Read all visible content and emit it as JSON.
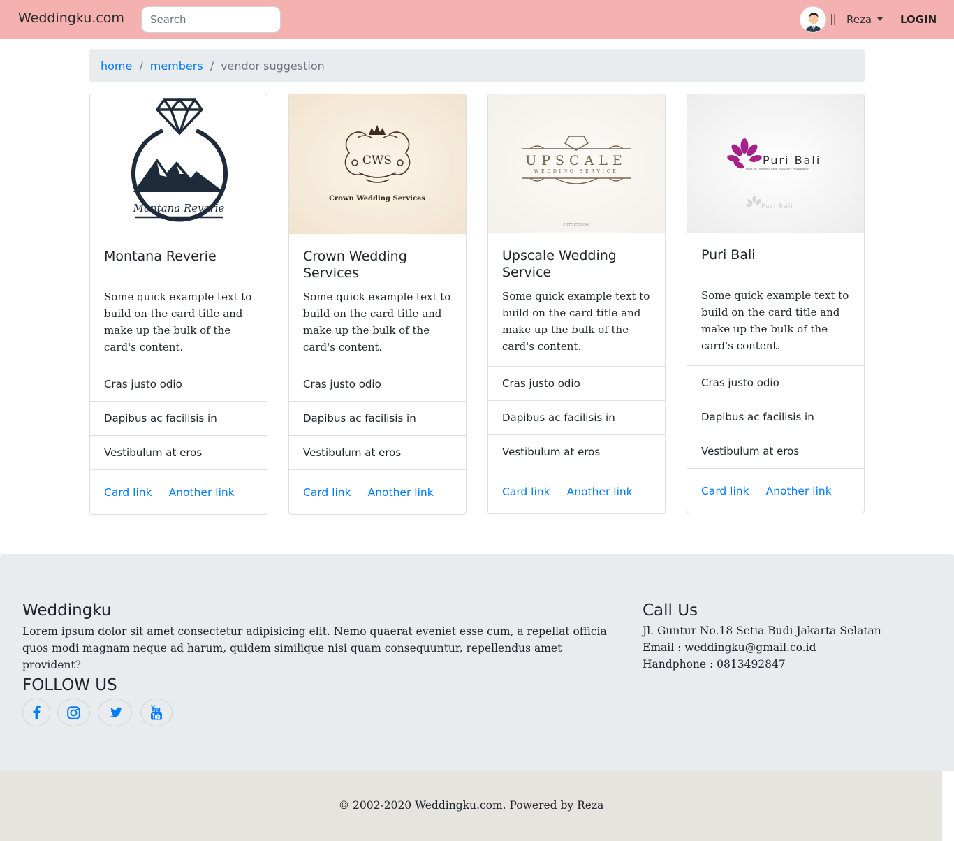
{
  "navbar": {
    "brand": "Weddingku.com",
    "search_placeholder": "Search",
    "divider": "||",
    "user_name": "Reza",
    "login_label": "LOGIN"
  },
  "breadcrumb": {
    "items": [
      "home",
      "members"
    ],
    "separator": "/",
    "active": "vendor suggestion"
  },
  "cards": [
    {
      "title": "Montana Reverie",
      "logo_text": "Montana Reverie",
      "text": "Some quick example text to build on the card title and make up the bulk of the card's content.",
      "list": [
        "Cras justo odio",
        "Dapibus ac facilisis in",
        "Vestibulum at eros"
      ],
      "link1": "Card link",
      "link2": "Another link"
    },
    {
      "title": "Crown Wedding Services",
      "logo_text": "CWS",
      "logo_subtext": "Crown Wedding Services",
      "text": "Some quick example text to build on the card title and make up the bulk of the card's content.",
      "list": [
        "Cras justo odio",
        "Dapibus ac facilisis in",
        "Vestibulum at eros"
      ],
      "link1": "Card link",
      "link2": "Another link"
    },
    {
      "title": "Upscale Wedding Service",
      "logo_text": "UPSCALE",
      "logo_subtext": "WEDDING SERVICE",
      "logo_footer": "FOTOJET.COM",
      "text": "Some quick example text to build on the card title and make up the bulk of the card's content.",
      "list": [
        "Cras justo odio",
        "Dapibus ac facilisis in",
        "Vestibulum at eros"
      ],
      "link1": "Card link",
      "link2": "Another link"
    },
    {
      "title": "Puri Bali",
      "logo_text": "Puri Bali",
      "logo_subtext": "Make Up · Wedding Card · Souvenir · Photography",
      "text": "Some quick example text to build on the card title and make up the bulk of the card's content.",
      "list": [
        "Cras justo odio",
        "Dapibus ac facilisis in",
        "Vestibulum at eros"
      ],
      "link1": "Card link",
      "link2": "Another link"
    }
  ],
  "footer": {
    "about_title": "Weddingku",
    "about_text": "Lorem ipsum dolor sit amet consectetur adipisicing elit. Nemo quaerat eveniet esse cum, a repellat officia quos modi magnam neque ad harum, quidem similique nisi quam consequuntur, repellendus amet provident?",
    "follow_title": "FOLLOW US",
    "social": [
      "facebook-icon",
      "instagram-icon",
      "twitter-icon",
      "youtube-icon"
    ],
    "call_title": "Call Us",
    "address": "Jl. Guntur No.18 Setia Budi Jakarta Selatan",
    "email": "Email : weddingku@gmail.co.id",
    "phone": "Handphone : 0813492847",
    "copyright": "© 2002-2020 Weddingku.com. Powered by Reza"
  },
  "colors": {
    "navbar_bg": "#f5b0b0",
    "link": "#007bff",
    "footer_bg": "#e9ecef",
    "copyright_bg": "#e5e4de"
  }
}
